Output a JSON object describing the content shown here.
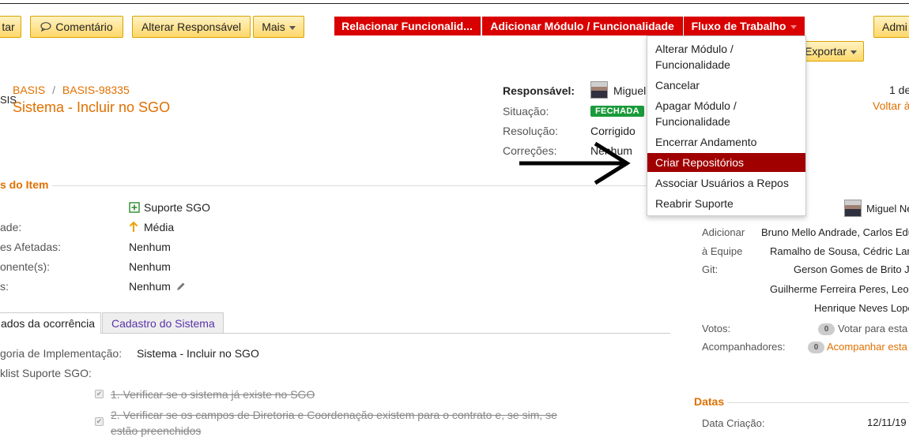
{
  "toolbar": {
    "tar": "tar",
    "comment": "Comentário",
    "alter_assignee": "Alterar Responsável",
    "more": "Mais",
    "relate_feature": "Relacionar Funcionalid...",
    "add_module": "Adicionar Módulo / Funcionalidade",
    "workflow": "Fluxo de Trabalho",
    "admin": "Admi",
    "export": "Exportar"
  },
  "header": {
    "left_fragment": "SIS",
    "crumb_project": "BASIS",
    "crumb_sep": "/",
    "crumb_issue": "BASIS-98335",
    "title": "Sistema - Incluir no SGO",
    "pager": "1 de",
    "back": "Voltar à"
  },
  "people": {
    "responsible_label": "Responsável:",
    "responsible_value": "Miguel",
    "status_label": "Situação:",
    "status_value": "FECHADA",
    "resolution_label": "Resolução:",
    "resolution_value": "Corrigido",
    "fixes_label": "Correções:",
    "fixes_value": "Nenhum"
  },
  "workflow_menu": {
    "items": [
      "Alterar Módulo / Funcionalidade",
      "Cancelar",
      "Apagar Módulo / Funcionalidade",
      "Encerrar Andamento",
      "Criar Repositórios",
      "Associar Usuários a Repos",
      "Reabrir Suporte"
    ],
    "selected": "Criar Repositórios"
  },
  "details": {
    "section_title": "s do Item",
    "rows": [
      {
        "label": "",
        "value": "Suporte SGO"
      },
      {
        "label": "ade:",
        "value": "Média"
      },
      {
        "label": "es Afetadas:",
        "value": "Nenhum"
      },
      {
        "label": "onente(s):",
        "value": "Nenhum"
      },
      {
        "label": "s:",
        "value": "Nenhum"
      }
    ]
  },
  "tabs": {
    "active": "ados da ocorrência",
    "other": "Cadastro do Sistema"
  },
  "tab_content": {
    "category_label": "goria de Implementação:",
    "category_value": "Sistema - Incluir no SGO",
    "checklist_label": "klist Suporte SGO:",
    "checklist_items": [
      "1. Verificar se o sistema já existe no SGO",
      "2. Verificar se os campos de Diretoria e Coordenação existem para o contrato e, se sim, se",
      "estão preenchidos"
    ]
  },
  "side": {
    "person": "Miguel Ne",
    "add_label_1": "Adicionar",
    "add_label_2": "à Equipe",
    "add_label_3": "Git:",
    "team_lines": [
      "Bruno Mello Andrade, Carlos Edu",
      "Ramalho de Sousa, Cédric Lar",
      "Gerson Gomes de Brito J",
      "Guilherme Ferreira Peres, Leor",
      "Henrique Neves Lope"
    ],
    "votes_label": "Votos:",
    "votes_count": "0",
    "votes_link": "Votar para esta",
    "watchers_label": "Acompanhadores:",
    "watchers_count": "0",
    "watchers_link": "Acompanhar esta",
    "dates_title": "Datas",
    "created_label": "Data Criação:",
    "created_value": "12/11/19"
  }
}
